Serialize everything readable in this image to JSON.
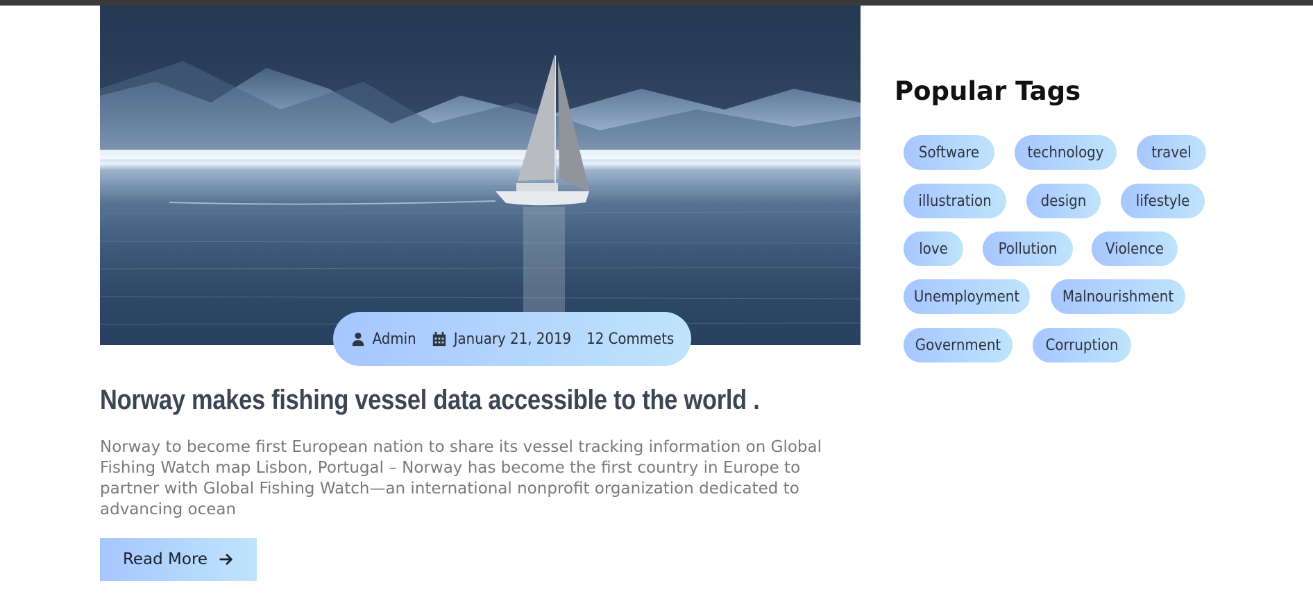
{
  "post": {
    "meta": {
      "author": "Admin",
      "date": "January 21, 2019",
      "comments": "12 Commets"
    },
    "title": "Norway makes fishing vessel data accessible to the world .",
    "excerpt": "Norway to become first European nation to share its vessel tracking information on Global Fishing Watch map Lisbon, Portugal – Norway has become the first country in Europe to partner with Global Fishing Watch—an international nonprofit organization dedicated to advancing ocean",
    "read_more_label": "Read More",
    "image_subject": "sailboat on calm lake with mountains"
  },
  "sidebar": {
    "popular_tags_title": "Popular Tags",
    "tags": [
      "Software",
      "technology",
      "travel",
      "illustration",
      "design",
      "lifestyle",
      "love",
      "Pollution",
      "Violence",
      "Unemployment",
      "Malnourishment",
      "Government",
      "Corruption"
    ]
  },
  "colors": {
    "accent_gradient_start": "#a6c6ff",
    "accent_gradient_end": "#bfe4fb",
    "title": "#3b4654",
    "body_text": "#7a7a7a"
  },
  "icons": {
    "author": "user-icon",
    "date": "calendar-icon",
    "read_more": "arrow-right-icon"
  }
}
